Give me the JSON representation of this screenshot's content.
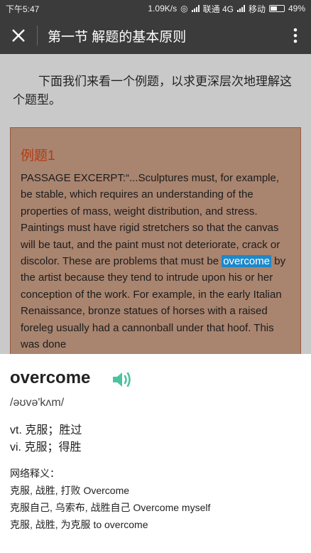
{
  "status": {
    "time": "下午5:47",
    "speed": "1.09K/s",
    "carrier1": "联通 4G",
    "carrier2": "移动",
    "battery": "49%",
    "battery_level": 0.49
  },
  "appbar": {
    "title": "第一节 解题的基本原则"
  },
  "intro": "下面我们来看一个例题，以求更深层次地理解这个题型。",
  "example": {
    "heading": "例题1",
    "text_before": "PASSAGE EXCERPT:“...Sculptures must, for example, be stable, which requires an understanding of the properties of mass, weight distribution, and stress. Paintings must have rigid stretchers so that the canvas will be taut, and the paint must not deteriorate, crack or discolor. These are problems that must be ",
    "highlight": "overcome",
    "text_after": " by the artist because they tend to intrude upon his or her conception of the work. For example, in the early Italian Renaissance, bronze statues of horses with a raised foreleg usually had a cannonball under that hoof. This was done"
  },
  "dictionary": {
    "word": "overcome",
    "phonetic": "/əʊvə'kʌm/",
    "definitions": [
      "vt. 克服；胜过",
      "vi. 克服；得胜"
    ],
    "net_title": "网络释义：",
    "net_items": [
      "克服, 战胜, 打败 Overcome",
      "克服自己, 乌索布, 战胜自己 Overcome myself",
      "克服, 战胜, 为克服 to overcome"
    ]
  },
  "colors": {
    "bar": "#3b3b3b",
    "example_bg": "#a9846f",
    "heading": "#b53a12",
    "highlight": "#1e88c8",
    "speaker": "#4cc3a0"
  }
}
